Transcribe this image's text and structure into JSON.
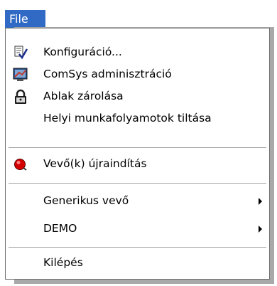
{
  "menubar": {
    "title": "File"
  },
  "menu": {
    "items": [
      {
        "label": "Konfiguráció...",
        "icon": "config-checklist-icon"
      },
      {
        "label": "ComSys adminisztráció",
        "icon": "comsys-admin-icon"
      },
      {
        "label": "Ablak zárolása",
        "icon": "lock-icon"
      },
      {
        "label": "Helyi munkafolyamotok tiltása"
      },
      {
        "label": "Vevő(k) újraindítás",
        "icon": "red-record-icon"
      },
      {
        "label": "Generikus vevő",
        "submenu": true
      },
      {
        "label": "DEMO",
        "submenu": true
      },
      {
        "label": "Kilépés"
      }
    ]
  },
  "colors": {
    "highlight": "#316ac5",
    "shadow": "#a9a9a9",
    "border": "#6e6e6e"
  }
}
